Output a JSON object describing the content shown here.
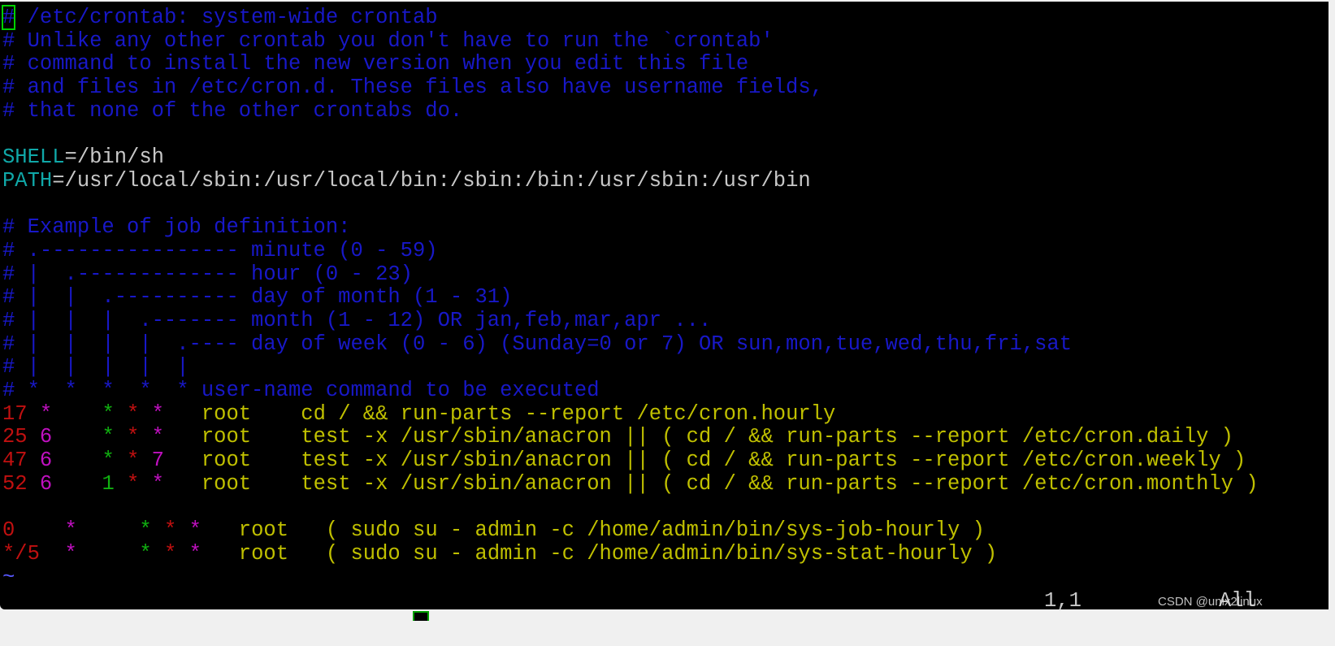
{
  "colors": {
    "comment": "#1818c8",
    "cyan": "#10a8a8",
    "gray": "#c8c8c8",
    "red": "#c01010",
    "magenta": "#c010c0",
    "green": "#10b010",
    "yellow": "#c0c000",
    "tilde": "#5858ff",
    "cursor": "#00d000"
  },
  "lines": [
    {
      "segments": [
        {
          "text": "#",
          "color": "comment",
          "cursor": true
        },
        {
          "text": " /etc/crontab: system-wide crontab",
          "color": "comment"
        }
      ]
    },
    {
      "segments": [
        {
          "text": "# Unlike any other crontab you don't have to run the `crontab'",
          "color": "comment"
        }
      ]
    },
    {
      "segments": [
        {
          "text": "# command to install the new version when you edit this file",
          "color": "comment"
        }
      ]
    },
    {
      "segments": [
        {
          "text": "# and files in /etc/cron.d. These files also have username fields,",
          "color": "comment"
        }
      ]
    },
    {
      "segments": [
        {
          "text": "# that none of the other crontabs do.",
          "color": "comment"
        }
      ]
    },
    {
      "segments": []
    },
    {
      "segments": [
        {
          "text": "SHELL",
          "color": "cyan"
        },
        {
          "text": "=/bin/sh",
          "color": "gray"
        }
      ]
    },
    {
      "segments": [
        {
          "text": "PATH",
          "color": "cyan"
        },
        {
          "text": "=/usr/local/sbin:/usr/local/bin:/sbin:/bin:/usr/sbin:/usr/bin",
          "color": "gray"
        }
      ]
    },
    {
      "segments": []
    },
    {
      "segments": [
        {
          "text": "# Example of job definition:",
          "color": "comment"
        }
      ]
    },
    {
      "segments": [
        {
          "text": "# .---------------- minute (0 - 59)",
          "color": "comment"
        }
      ]
    },
    {
      "segments": [
        {
          "text": "# |  .------------- hour (0 - 23)",
          "color": "comment"
        }
      ]
    },
    {
      "segments": [
        {
          "text": "# |  |  .---------- day of month (1 - 31)",
          "color": "comment"
        }
      ]
    },
    {
      "segments": [
        {
          "text": "# |  |  |  .------- month (1 - 12) OR jan,feb,mar,apr ...",
          "color": "comment"
        }
      ]
    },
    {
      "segments": [
        {
          "text": "# |  |  |  |  .---- day of week (0 - 6) (Sunday=0 or 7) OR sun,mon,tue,wed,thu,fri,sat",
          "color": "comment"
        }
      ]
    },
    {
      "segments": [
        {
          "text": "# |  |  |  |  |",
          "color": "comment"
        }
      ]
    },
    {
      "segments": [
        {
          "text": "# *  *  *  *  * user-name command to be executed",
          "color": "comment"
        }
      ]
    },
    {
      "segments": [
        {
          "text": "17 ",
          "color": "red"
        },
        {
          "text": "*    ",
          "color": "magenta"
        },
        {
          "text": "* ",
          "color": "green"
        },
        {
          "text": "* ",
          "color": "red"
        },
        {
          "text": "*",
          "color": "magenta"
        },
        {
          "text": "   root    cd / && run-parts --report /etc/cron.hourly",
          "color": "yellow"
        }
      ]
    },
    {
      "segments": [
        {
          "text": "25 ",
          "color": "red"
        },
        {
          "text": "6    ",
          "color": "magenta"
        },
        {
          "text": "* ",
          "color": "green"
        },
        {
          "text": "* ",
          "color": "red"
        },
        {
          "text": "*",
          "color": "magenta"
        },
        {
          "text": "   root    test -x /usr/sbin/anacron || ( cd / && run-parts --report /etc/cron.daily )",
          "color": "yellow"
        }
      ]
    },
    {
      "segments": [
        {
          "text": "47 ",
          "color": "red"
        },
        {
          "text": "6    ",
          "color": "magenta"
        },
        {
          "text": "* ",
          "color": "green"
        },
        {
          "text": "* ",
          "color": "red"
        },
        {
          "text": "7",
          "color": "magenta"
        },
        {
          "text": "   root    test -x /usr/sbin/anacron || ( cd / && run-parts --report /etc/cron.weekly )",
          "color": "yellow"
        }
      ]
    },
    {
      "segments": [
        {
          "text": "52 ",
          "color": "red"
        },
        {
          "text": "6    ",
          "color": "magenta"
        },
        {
          "text": "1 ",
          "color": "green"
        },
        {
          "text": "* ",
          "color": "red"
        },
        {
          "text": "*",
          "color": "magenta"
        },
        {
          "text": "   root    test -x /usr/sbin/anacron || ( cd / && run-parts --report /etc/cron.monthly )",
          "color": "yellow"
        }
      ]
    },
    {
      "segments": []
    },
    {
      "segments": [
        {
          "text": "0    ",
          "color": "red"
        },
        {
          "text": "*    ",
          "color": "magenta"
        },
        {
          "text": " * ",
          "color": "green"
        },
        {
          "text": "* ",
          "color": "red"
        },
        {
          "text": "*",
          "color": "magenta"
        },
        {
          "text": "   root   ( sudo su - admin -c /home/admin/bin/sys-job-hourly )",
          "color": "yellow"
        }
      ]
    },
    {
      "segments": [
        {
          "text": "*/5  ",
          "color": "red"
        },
        {
          "text": "*    ",
          "color": "magenta"
        },
        {
          "text": " * ",
          "color": "green"
        },
        {
          "text": "* ",
          "color": "red"
        },
        {
          "text": "*",
          "color": "magenta"
        },
        {
          "text": "   root   ( sudo su - admin -c /home/admin/bin/sys-stat-hourly )",
          "color": "yellow"
        }
      ]
    },
    {
      "segments": [
        {
          "text": "~",
          "color": "tilde"
        }
      ]
    }
  ],
  "status": {
    "position": "1,1",
    "scroll": "All"
  },
  "watermark": "CSDN @unix2linux"
}
